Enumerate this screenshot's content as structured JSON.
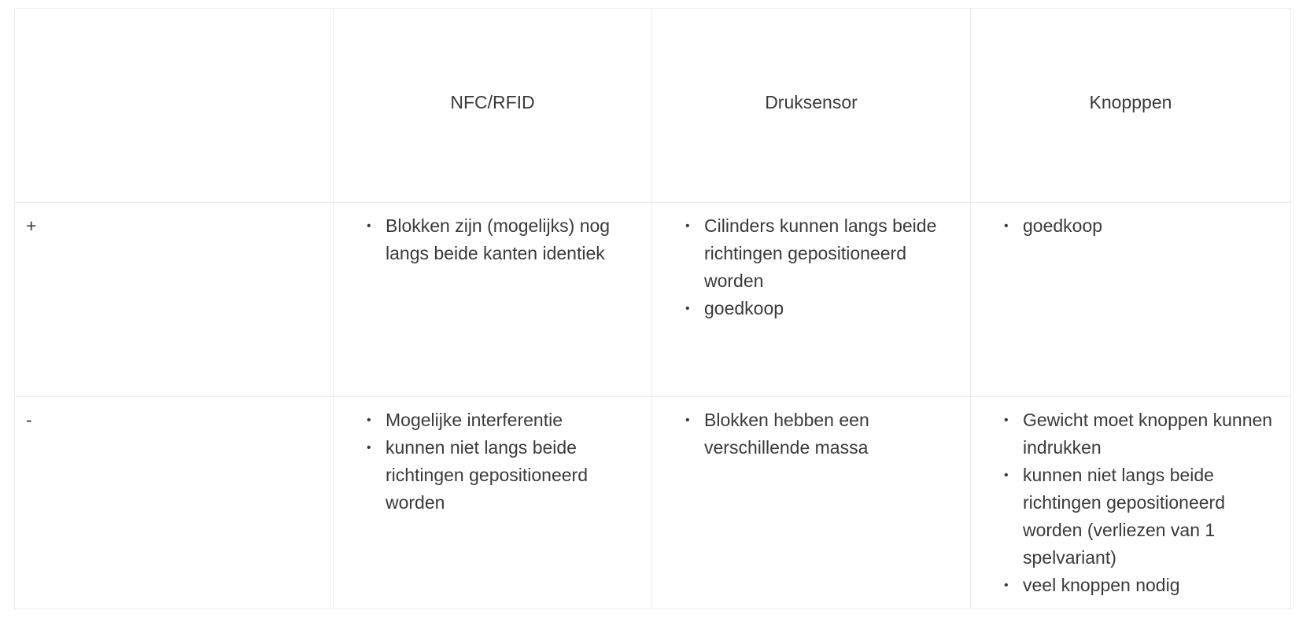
{
  "table": {
    "headers": [
      "",
      "NFC/RFID",
      "Druksensor",
      "Knopppen"
    ],
    "rows": [
      {
        "label": "+",
        "cells": [
          [
            "Blokken zijn (mogelijks) nog langs beide kanten identiek"
          ],
          [
            "Cilinders kunnen langs beide richtingen gepositioneerd worden",
            "goedkoop"
          ],
          [
            "goedkoop"
          ]
        ]
      },
      {
        "label": "-",
        "cells": [
          [
            "Mogelijke interferentie",
            "kunnen niet langs beide richtingen gepositioneerd worden"
          ],
          [
            "Blokken hebben een verschillende massa"
          ],
          [
            "Gewicht moet knoppen kunnen indrukken",
            "kunnen niet langs beide richtingen gepositioneerd worden (verliezen van 1 spelvariant)",
            "veel knoppen nodig"
          ]
        ]
      }
    ]
  },
  "colors": {
    "border": "#ececec",
    "text": "#3a3a3a"
  }
}
